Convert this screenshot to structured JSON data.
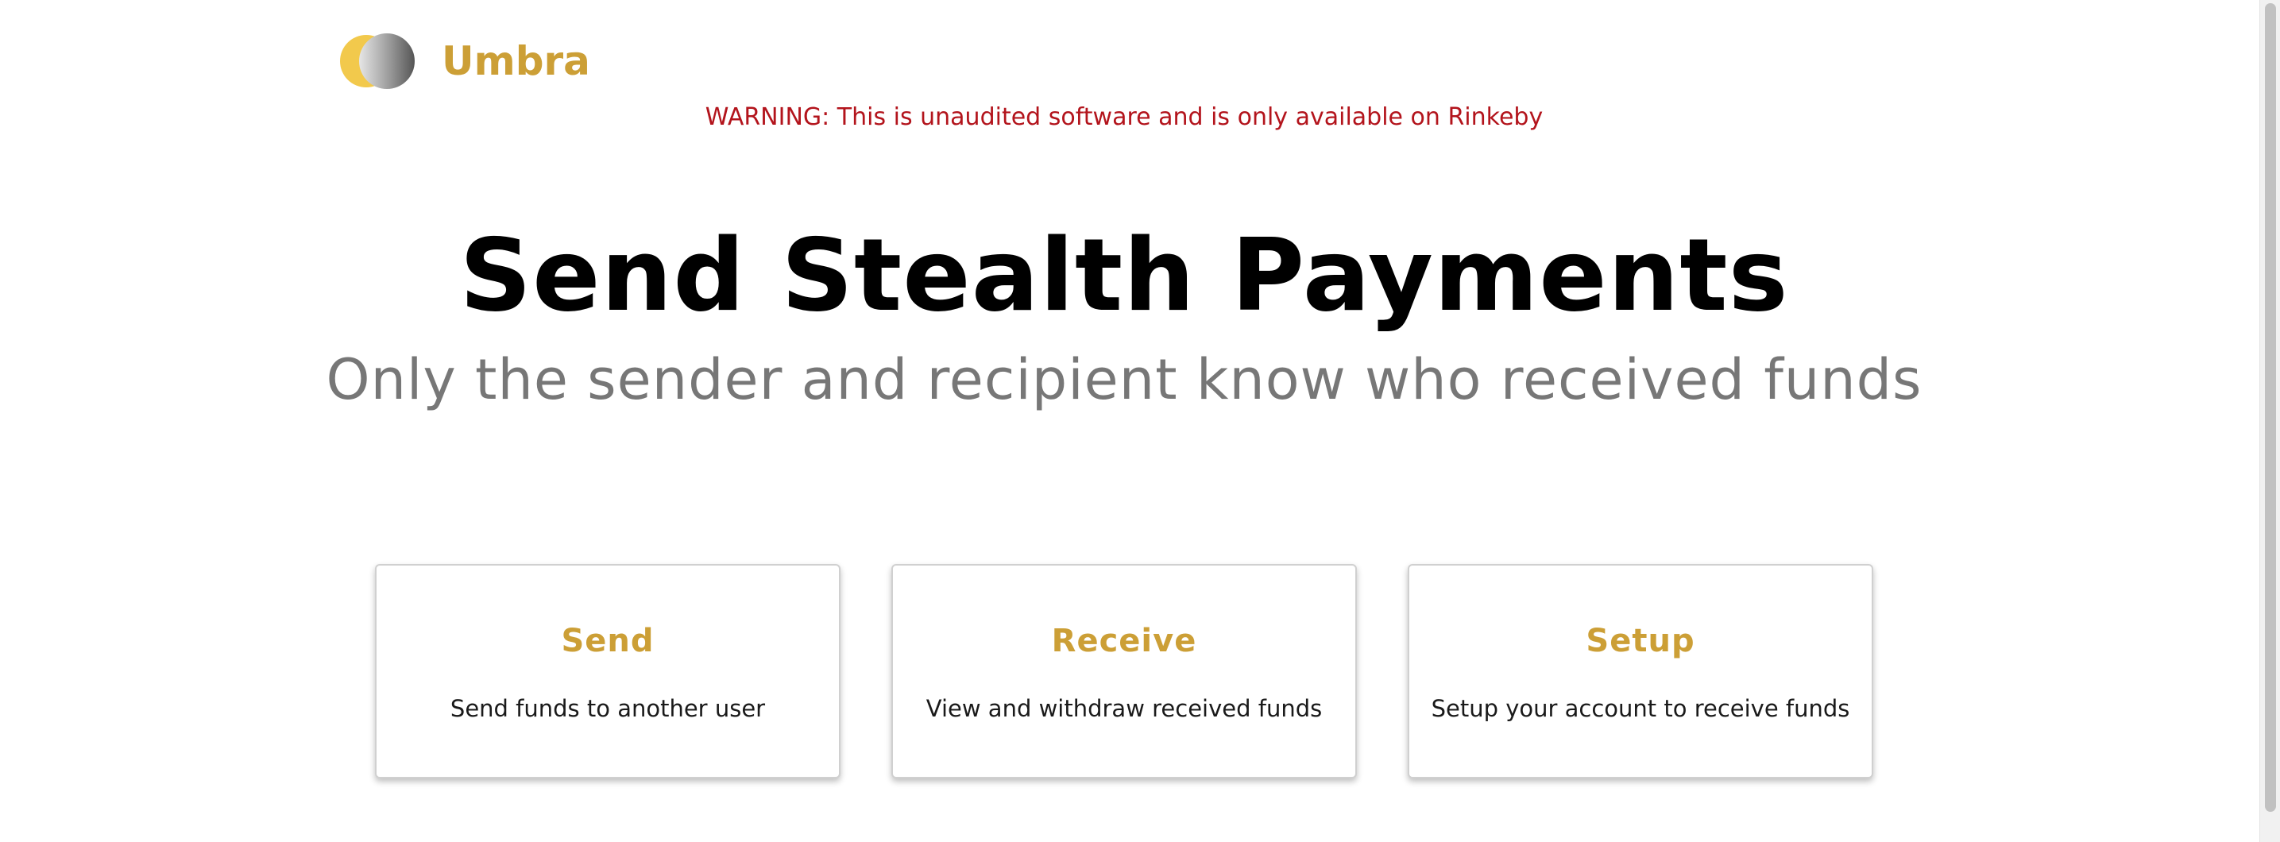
{
  "header": {
    "logo_icon": "umbra-eclipse-logo",
    "brand": "Umbra",
    "warning": "WARNING: This is unaudited software and is only available on Rinkeby"
  },
  "hero": {
    "title": "Send Stealth Payments",
    "subtitle": "Only the sender and recipient know who received funds"
  },
  "cards": [
    {
      "title": "Send",
      "description": "Send funds to another user"
    },
    {
      "title": "Receive",
      "description": "View and withdraw received funds"
    },
    {
      "title": "Setup",
      "description": "Setup your account to receive funds"
    }
  ],
  "colors": {
    "accent": "#cc9f36",
    "warning": "#b3141c",
    "subtitle": "#777777"
  }
}
